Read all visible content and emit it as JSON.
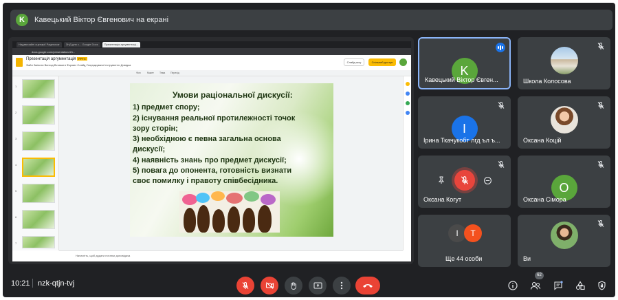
{
  "banner": {
    "avatar_letter": "K",
    "text": "Кавецький Віктор Євгенович на екрані"
  },
  "presentation": {
    "browser_tabs": [
      "Надзвичайні сценарії Pagesovar",
      "ЗНД для с. - Google Docs",
      "Презентація аргументаці..."
    ],
    "address": "docs.google.com/presentation/d/1...",
    "doc_title": "Презентація аргументація",
    "doc_badge": "PPTX",
    "menu": "Файл  Змінити  Вигляд  Вставити  Формат  Слайд  Упорядкувати  Інструменти  Довідка",
    "slideshow_label": "Слайд-шоу",
    "share_label": "Спільний доступ",
    "toolbar_items": [
      "Фон",
      "Макет",
      "Тема",
      "Перехід"
    ],
    "slide_lines": [
      "Умови раціональної дискусії:",
      "1)    предмет спору;",
      " 2) існування реальної протилежності точок",
      " зору  сторін;",
      "3) необхідною є певна загальна основа",
      "дискусії;",
      "4) наявність знань про предмет дискусії;",
      "5) повага до опонента, готовність визнати",
      "своє помилку і правоту співбесідника."
    ],
    "notes_placeholder": "Натисніть, щоб додати нотатки доповідача",
    "thumbnail_numbers": [
      "1",
      "2",
      "3",
      "4",
      "5",
      "6",
      "7"
    ]
  },
  "tiles": [
    {
      "name": "Кавецький Віктор Євген...",
      "avatar": "K",
      "color": "#5aa63b",
      "active": true
    },
    {
      "name": "Школа Колосова",
      "photo": "school"
    },
    {
      "name": "Ірина Ткачукобт лгд ъл ъ...",
      "avatar": "І",
      "color": "#1a73e8"
    },
    {
      "name": "Оксана Коцій",
      "photo": "woman"
    },
    {
      "name": "Оксана Когут",
      "hover": true
    },
    {
      "name": "Оксана Сімора",
      "avatar": "О",
      "color": "#5aa63b"
    },
    {
      "name": "Ще 44 особи",
      "avatar1": "І",
      "avatar2": "Т",
      "color1": "#4a4a4a",
      "color2": "#f4511e"
    },
    {
      "name": "Ви",
      "photo": "self"
    }
  ],
  "bottom": {
    "time": "10:21",
    "meeting_code": "nzk-qtjn-tvj",
    "participants_count": "62"
  },
  "colors": {
    "accent": "#8ab4f8",
    "end_call": "#ea4335",
    "panel": "#3c4043",
    "background": "#202124"
  }
}
